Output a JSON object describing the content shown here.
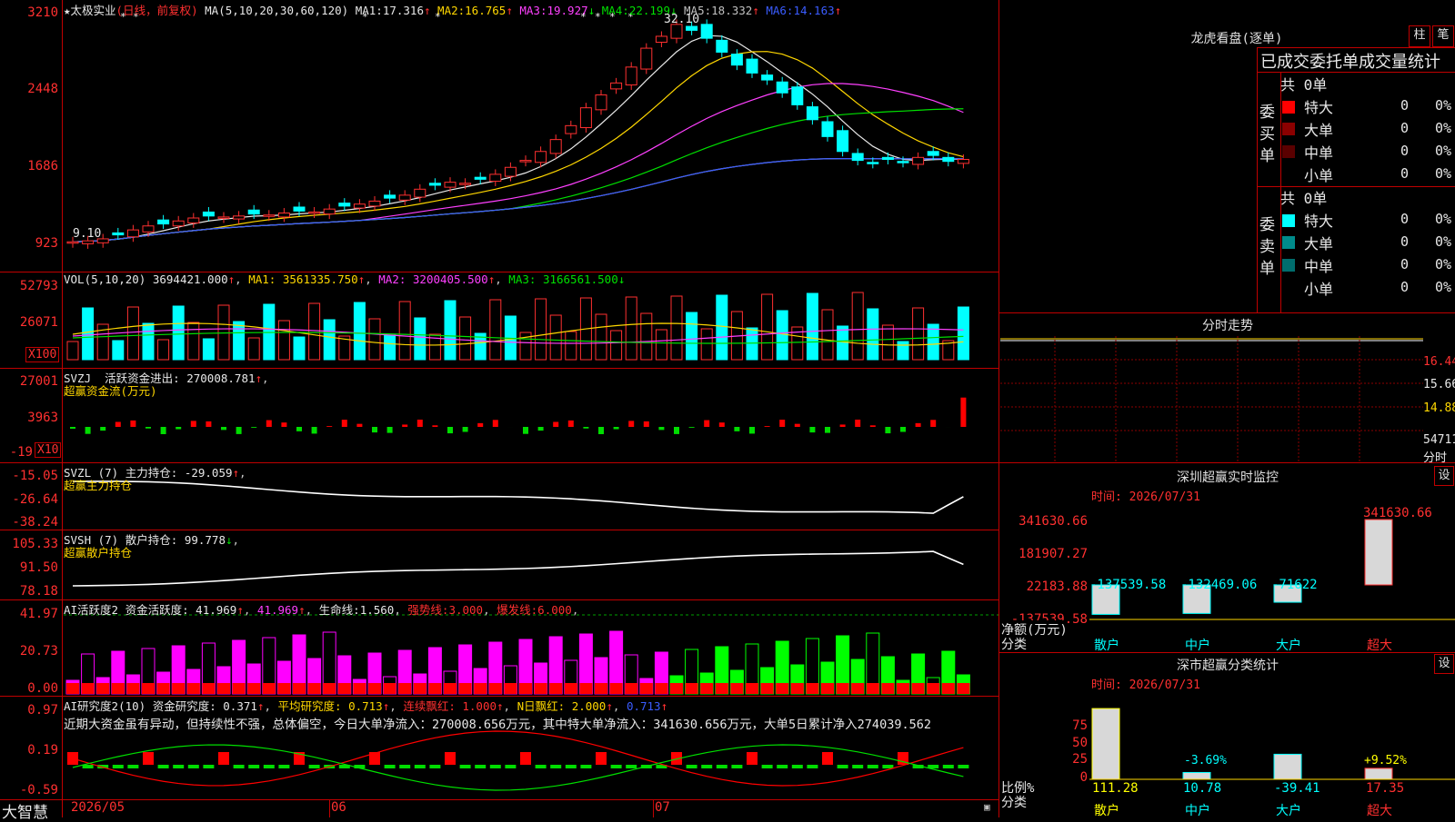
{
  "stock": {
    "name": "太极实业",
    "period": "(日线，前复权)",
    "star": "★"
  },
  "main_chart": {
    "ma_params": "MA(5,10,20,30,60,120)",
    "ma": [
      {
        "label": "MA1:",
        "value": "17.316",
        "arrow": "↑",
        "color": "#e8e8e8"
      },
      {
        "label": "MA2:",
        "value": "16.765",
        "arrow": "↑",
        "color": "#ffd700"
      },
      {
        "label": "MA3:",
        "value": "19.927",
        "arrow": "↓",
        "color": "#ff40ff"
      },
      {
        "label": "MA4:",
        "value": "22.199",
        "arrow": "↓",
        "color": "#00e000"
      },
      {
        "label": "MA5:",
        "value": "18.332",
        "arrow": "↑",
        "color": "#c0c0c0"
      },
      {
        "label": "MA6:",
        "value": "14.163",
        "arrow": "↑",
        "color": "#3a5cff"
      }
    ],
    "y_ticks": [
      "3210",
      "2448",
      "1686",
      "923"
    ],
    "high_label": "32.10",
    "low_label": "9.10"
  },
  "vol": {
    "label": "VOL(5,10,20)",
    "value": "3694421.000",
    "ma1": "3561335.750",
    "ma2": "3200405.500",
    "ma3": "3166561.500",
    "ma1_label": "MA1:",
    "ma2_label": "MA2:",
    "ma3_label": "MA3:",
    "y_ticks": [
      "52793",
      "26071"
    ],
    "unit": "X100"
  },
  "svzj": {
    "label": "SVZJ",
    "title": "活跃资金进出:",
    "value": "270008.781",
    "sub": "超赢资金流(万元)",
    "y_ticks": [
      "27001",
      "3963",
      "-19"
    ],
    "unit": "X10"
  },
  "svzl": {
    "label": "SVZL (7)",
    "title": "主力持仓:",
    "value": "-29.059",
    "sub": "超赢主力持仓",
    "y_ticks": [
      "-15.05",
      "-26.64",
      "-38.24"
    ]
  },
  "svsh": {
    "label": "SVSH (7)",
    "title": "散户持仓:",
    "value": "99.778",
    "sub": "超赢散户持仓",
    "y_ticks": [
      "105.33",
      "91.50",
      "78.18"
    ]
  },
  "ai_active": {
    "label": "AI活跃度2",
    "title": "资金活跃度:",
    "value": "41.969",
    "value2": "41.969",
    "life_label": "生命线:",
    "life": "1.560",
    "strong_label": "强势线:",
    "strong": "3.000",
    "burst_label": "爆发线:",
    "burst": "6.000",
    "y_ticks": [
      "41.97",
      "20.73",
      "0.00"
    ]
  },
  "ai_research": {
    "label": "AI研究度2(10)",
    "title": "资金研究度:",
    "value": "0.371",
    "avg_label": "平均研究度:",
    "avg": "0.713",
    "cont_label": "连续飘红:",
    "cont": "1.000",
    "n_label": "N日飘红:",
    "n": "2.000",
    "last": "0.713",
    "comment": "近期大资金虽有异动，但持续性不强，总体偏空，今日大单净流入：270008.656万元，其中特大单净流入：341630.656万元，大单5日累计净入274039.562",
    "y_ticks": [
      "0.97",
      "0.19",
      "-0.59"
    ]
  },
  "bottom": {
    "brand": "大智慧",
    "dates": [
      "2026/05",
      "06",
      "07"
    ]
  },
  "dragon": {
    "title": "龙虎看盘(逐单)",
    "btn1": "柱",
    "btn2": "笔",
    "header": "已成交委托单成交量统计",
    "buy": {
      "side": "委买单",
      "total": "共 0单",
      "rows": [
        {
          "name": "特大",
          "count": "0",
          "pct": "0%",
          "color": "#ff0000"
        },
        {
          "name": "大单",
          "count": "0",
          "pct": "0%",
          "color": "#8b0000"
        },
        {
          "name": "中单",
          "count": "0",
          "pct": "0%",
          "color": "#5a0000"
        },
        {
          "name": "小单",
          "count": "0",
          "pct": "0%",
          "color": "#000000"
        }
      ]
    },
    "sell": {
      "side": "委卖单",
      "total": "共 0单",
      "rows": [
        {
          "name": "特大",
          "count": "0",
          "pct": "0%",
          "color": "#00ffff"
        },
        {
          "name": "大单",
          "count": "0",
          "pct": "0%",
          "color": "#008b8b"
        },
        {
          "name": "中单",
          "count": "0",
          "pct": "0%",
          "color": "#006d6d"
        },
        {
          "name": "小单",
          "count": "0",
          "pct": "0%",
          "color": "#000000"
        }
      ]
    }
  },
  "intraday": {
    "title": "分时走势",
    "prices": [
      "16.44",
      "15.66",
      "14.88"
    ],
    "vol": "54711",
    "vol_label": "分时"
  },
  "sz_monitor": {
    "title": "深圳超赢实时监控",
    "btn": "设",
    "time": "时间: 2026/07/31",
    "y_ticks": [
      "341630.66",
      "181907.27",
      "22183.88",
      "-137539.58"
    ],
    "axis_label": "净额(万元)",
    "cat_label": "分类",
    "bars": [
      {
        "cat": "散户",
        "value": "-137539.58"
      },
      {
        "cat": "中户",
        "value": "-132469.06"
      },
      {
        "cat": "大户",
        "value": "-71622"
      },
      {
        "cat": "超大",
        "value": "341630.66"
      }
    ]
  },
  "ss_stats": {
    "title": "深市超赢分类统计",
    "btn": "设",
    "time": "时间: 2026/07/31",
    "y_ticks": [
      "75",
      "50",
      "25",
      "0"
    ],
    "axis_label": "比例%",
    "cat_label": "分类",
    "bars": [
      {
        "cat": "散户",
        "value": "111.28",
        "label": ""
      },
      {
        "cat": "中户",
        "value": "10.78",
        "label": "-3.69%"
      },
      {
        "cat": "大户",
        "value": "-39.41",
        "label": ""
      },
      {
        "cat": "超大",
        "value": "17.35",
        "label": "+9.52%"
      }
    ]
  },
  "colors": {
    "up": "#ff3030",
    "down": "#00ffff",
    "grid": "#c00000"
  }
}
